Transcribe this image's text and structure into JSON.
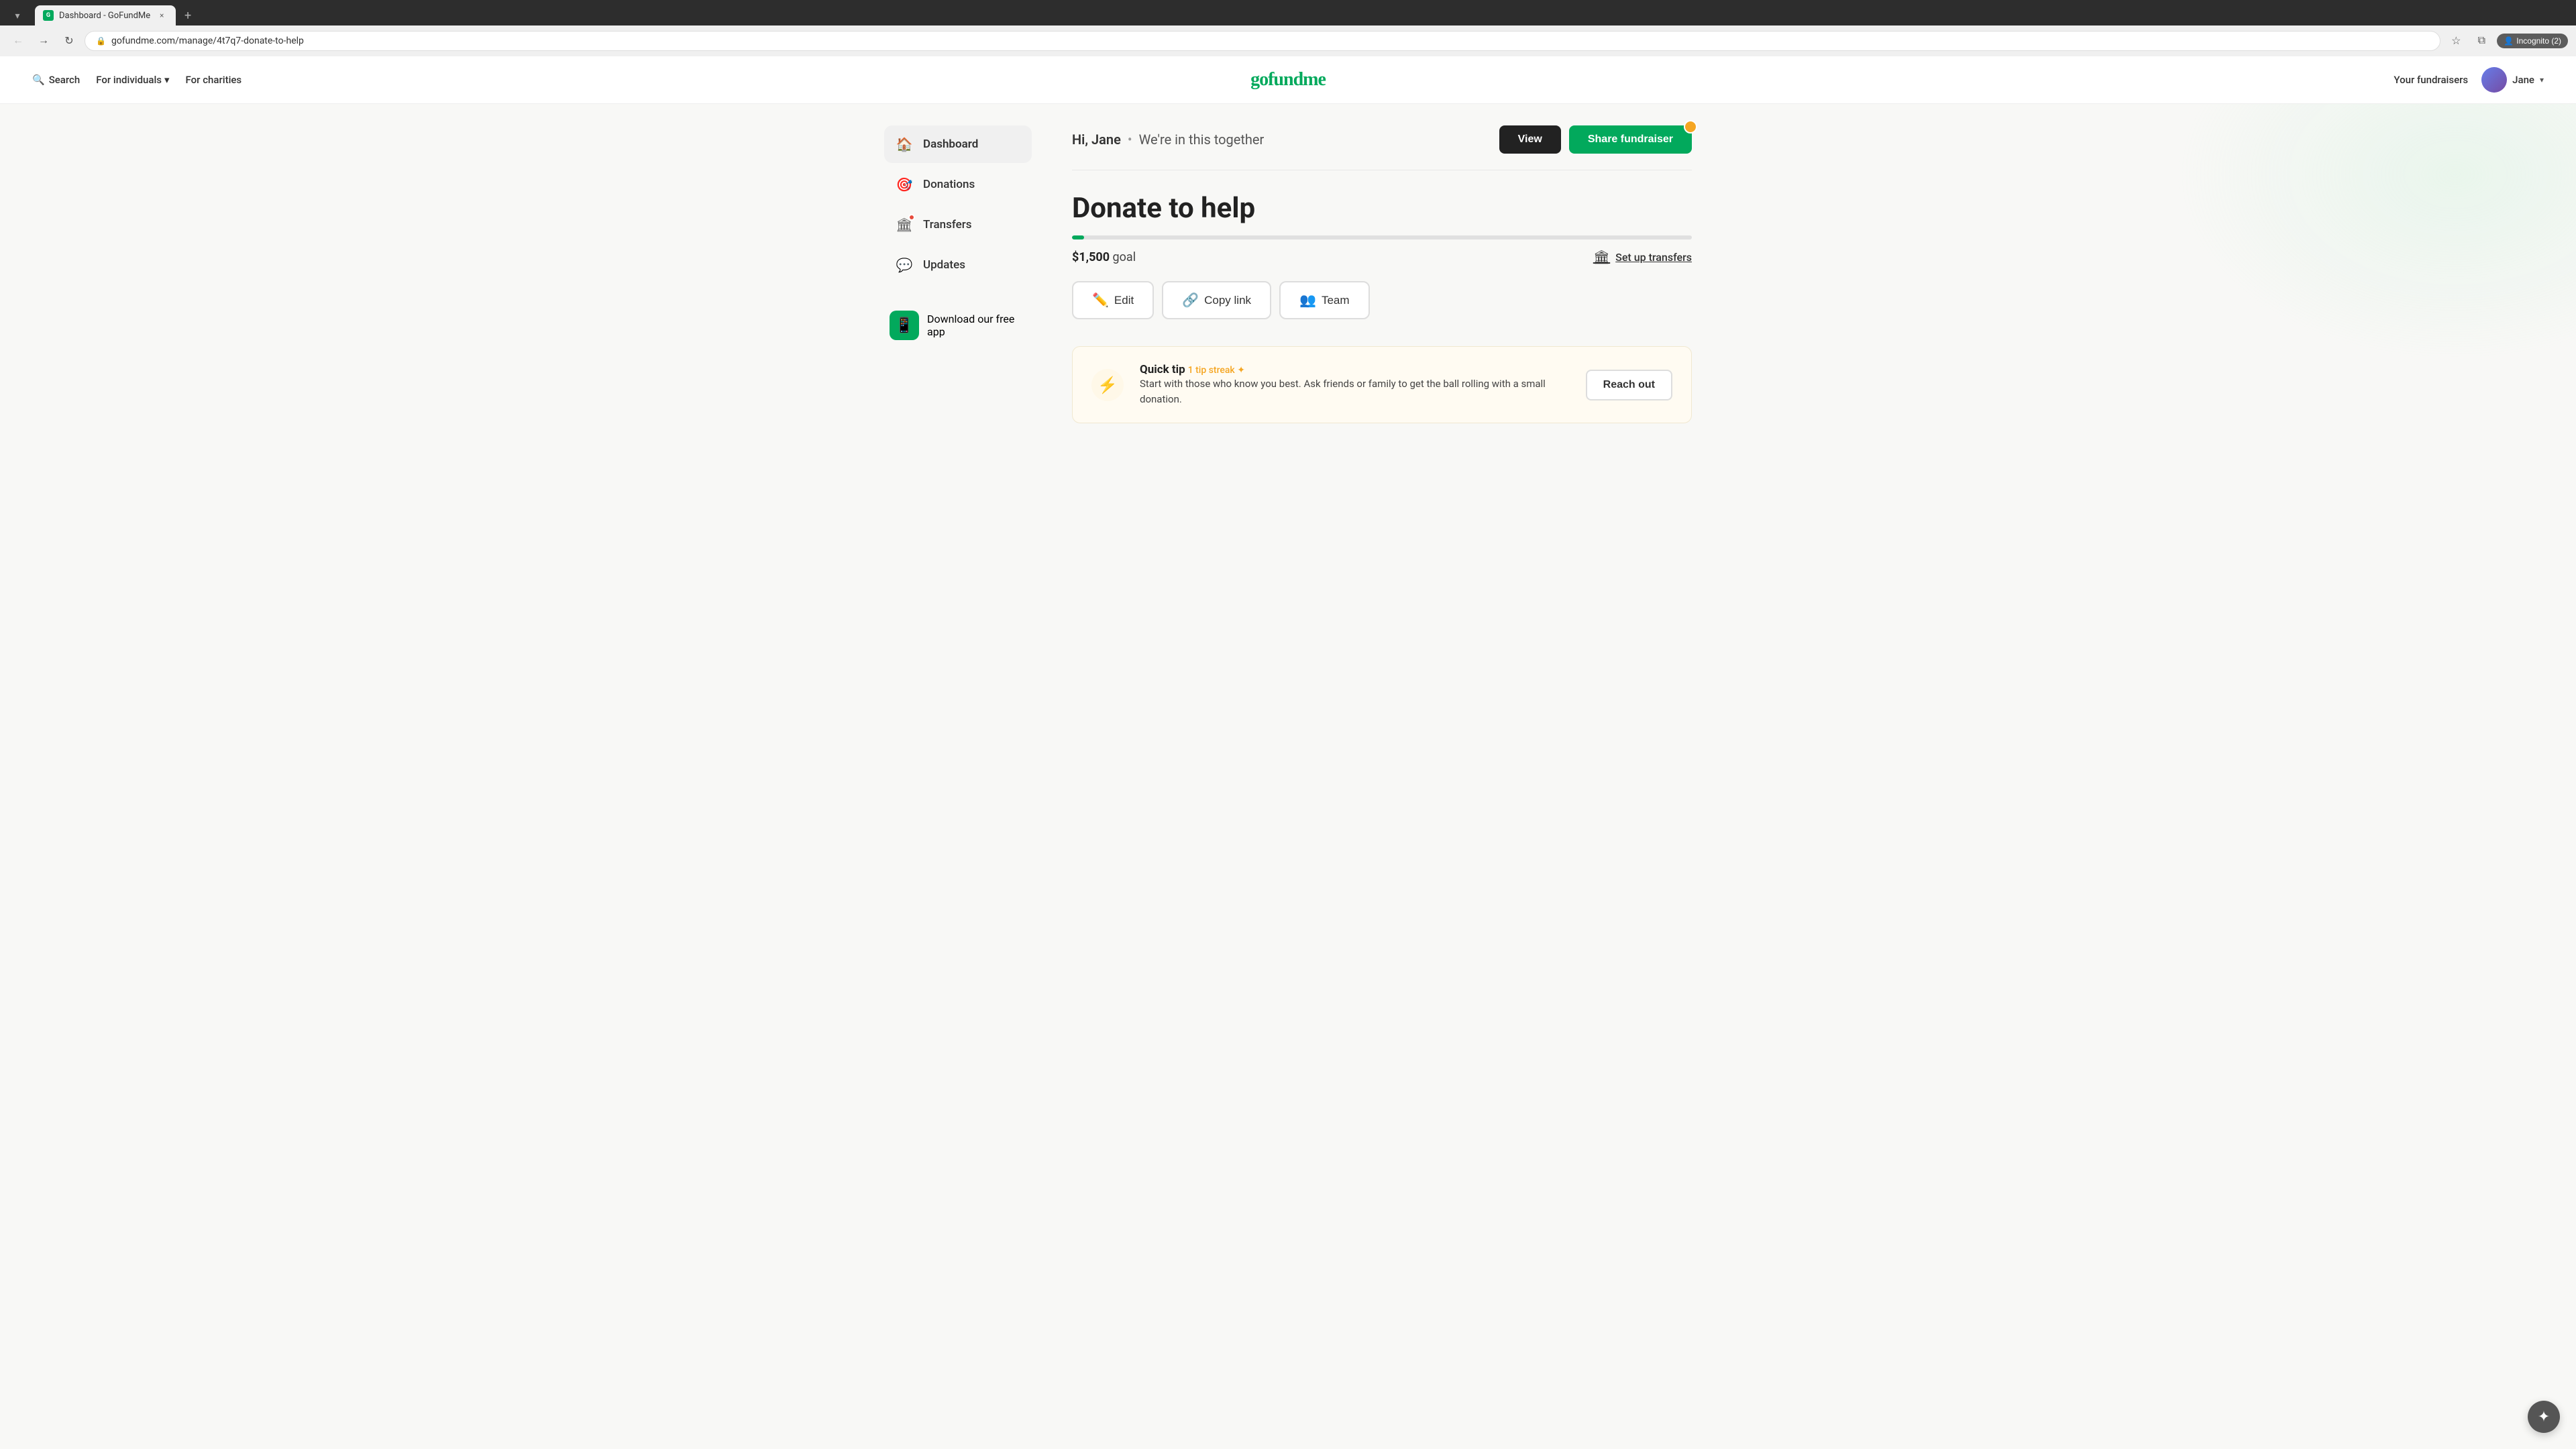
{
  "browser": {
    "tab": {
      "favicon": "G",
      "title": "Dashboard - GoFundMe",
      "close_label": "×"
    },
    "new_tab_label": "+",
    "toolbar": {
      "back_icon": "←",
      "forward_icon": "→",
      "reload_icon": "↻",
      "address": "gofundme.com/manage/4t7q7-donate-to-help",
      "bookmark_icon": "☆",
      "extensions_icon": "⧉",
      "incognito_label": "Incognito (2)"
    }
  },
  "nav": {
    "search_label": "Search",
    "for_individuals_label": "For individuals",
    "for_charities_label": "For charities",
    "logo": "gofundme",
    "your_fundraisers_label": "Your fundraisers",
    "user_name": "Jane",
    "chevron": "▾"
  },
  "sidebar": {
    "items": [
      {
        "id": "dashboard",
        "label": "Dashboard",
        "icon": "🏠",
        "active": true,
        "badge": false
      },
      {
        "id": "donations",
        "label": "Donations",
        "icon": "🎯",
        "active": false,
        "badge": false
      },
      {
        "id": "transfers",
        "label": "Transfers",
        "icon": "🏛",
        "active": false,
        "badge": true
      },
      {
        "id": "updates",
        "label": "Updates",
        "icon": "💬",
        "active": false,
        "badge": false
      }
    ],
    "download_app_label": "Download our free app"
  },
  "header": {
    "greeting_name": "Hi, Jane",
    "greeting_separator": "•",
    "greeting_sub": "We're in this together",
    "view_button": "View",
    "share_button": "Share fundraiser"
  },
  "fundraiser": {
    "title": "Donate to help",
    "progress_percent": 2,
    "goal_amount": "$1,500",
    "goal_label": "goal",
    "setup_transfers_label": "Set up transfers",
    "edit_label": "Edit",
    "copy_link_label": "Copy link",
    "team_label": "Team"
  },
  "quick_tip": {
    "lightning_icon": "⚡",
    "title": "Quick tip",
    "streak_label": "1 tip streak ✦",
    "text": "Start with those who know you best. Ask friends or family to get the ball rolling with a small donation.",
    "reach_out_label": "Reach out"
  },
  "chat": {
    "icon": "✦"
  }
}
